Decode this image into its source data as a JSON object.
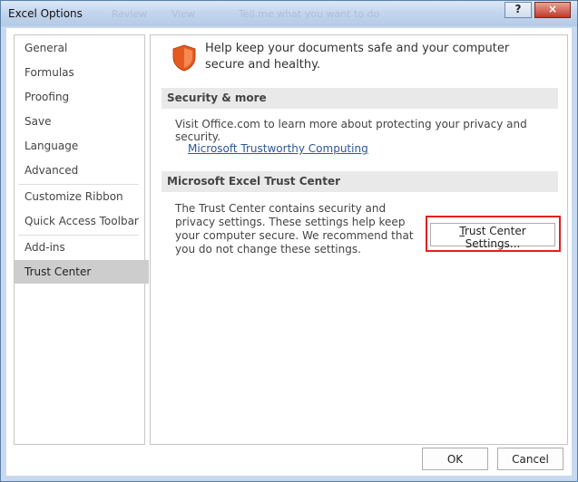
{
  "window": {
    "title": "Excel Options",
    "ghost_tabs": [
      "Review",
      "View"
    ],
    "ghost_search": "Tell me what you want to do",
    "help_button": "?",
    "close_button": "×"
  },
  "sidebar": {
    "items": [
      {
        "label": "General"
      },
      {
        "label": "Formulas"
      },
      {
        "label": "Proofing"
      },
      {
        "label": "Save"
      },
      {
        "label": "Language"
      },
      {
        "label": "Advanced"
      },
      {
        "label": "Customize Ribbon"
      },
      {
        "label": "Quick Access Toolbar"
      },
      {
        "label": "Add-ins"
      },
      {
        "label": "Trust Center"
      }
    ],
    "selected": "Trust Center"
  },
  "main": {
    "headline": "Help keep your documents safe and your computer secure and healthy.",
    "security_section": {
      "header": "Security & more",
      "description": "Visit Office.com to learn more about protecting your privacy and security.",
      "link": "Microsoft Trustworthy Computing"
    },
    "trust_center_section": {
      "header": "Microsoft Excel Trust Center",
      "description": "The Trust Center contains security and privacy settings. These settings help keep your computer secure. We recommend that you do not change these settings.",
      "button_first_letter": "T",
      "button_rest": "rust Center Settings..."
    }
  },
  "footer": {
    "ok": "OK",
    "cancel": "Cancel"
  },
  "colors": {
    "shield_orange": "#e55b1f",
    "highlight_red": "#e02020",
    "link_blue": "#2b579a",
    "selected_bg": "#cdcdcd"
  }
}
